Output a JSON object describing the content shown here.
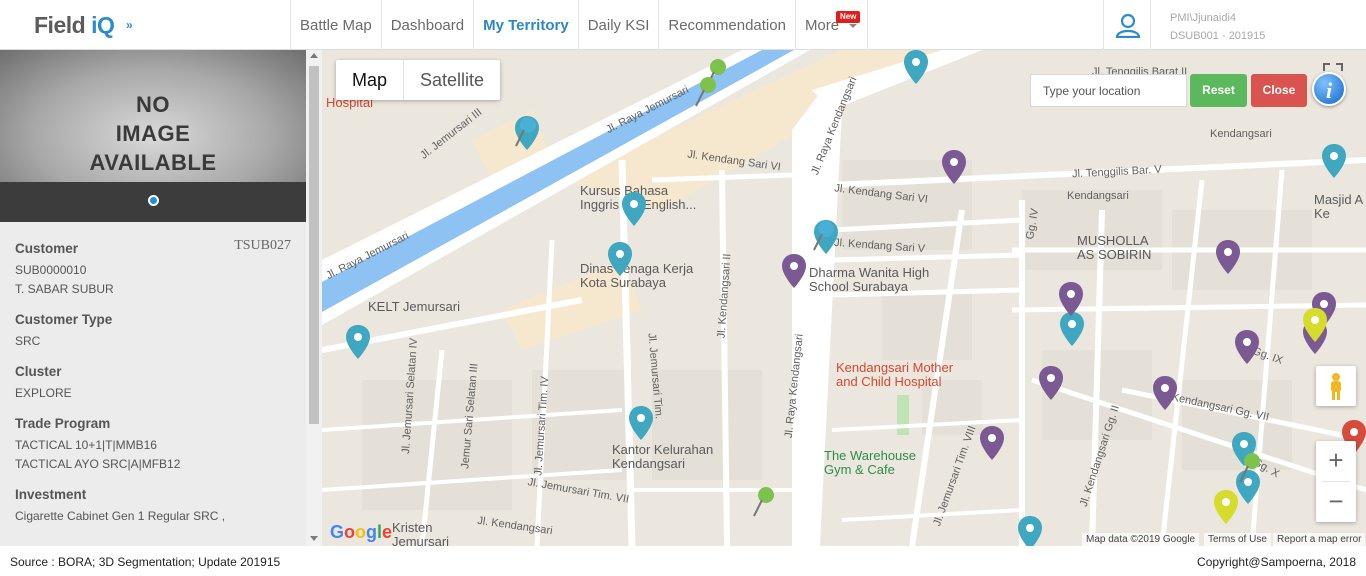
{
  "app": {
    "logo_text": "Field",
    "logo_accent": "iQ"
  },
  "nav": {
    "items": [
      {
        "label": "Battle Map"
      },
      {
        "label": "Dashboard"
      },
      {
        "label": "My Territory",
        "active": true
      },
      {
        "label": "Daily KSI"
      },
      {
        "label": "Recommendation"
      },
      {
        "label": "More"
      }
    ],
    "new_badge": "New"
  },
  "user": {
    "icon": "user-icon",
    "name": "PMI\\Jjunaidi4",
    "account": "DSUB001 - 201915"
  },
  "photo": {
    "placeholder_lines": [
      "NO",
      "IMAGE",
      "AVAILABLE"
    ]
  },
  "customer": {
    "customer_label": "Customer",
    "customer_code": "TSUB027",
    "customer_id": "SUB0000010",
    "customer_name": "T. SABAR SUBUR",
    "type_label": "Customer Type",
    "type_value": "SRC",
    "cluster_label": "Cluster",
    "cluster_value": "EXPLORE",
    "trade_label": "Trade Program",
    "trade_values": [
      "TACTICAL 10+1|T|MMB16",
      "TACTICAL AYO SRC|A|MFB12"
    ],
    "investment_label": "Investment",
    "investment_value": "Cigarette Cabinet Gen 1 Regular SRC ,"
  },
  "map": {
    "map_type": [
      "Map",
      "Satellite"
    ],
    "location_placeholder": "Type your location",
    "reset_label": "Reset",
    "close_label": "Close",
    "info_label": "i",
    "zoom_in": "+",
    "zoom_out": "−",
    "street_labels": [
      "Jl. Raya Jemursari",
      "Jl. Raya Jemursari",
      "Jl. Jemursari III",
      "Jl. Raya Kendangsari",
      "Jl. Kendang Sari VI",
      "Jl. Kendang Sari VI",
      "Jl. Kendang Sari V",
      "Jl. Tenggilis Bar. V",
      "Kendangsari",
      "Kendangsari",
      "Jl. Jemursari Tim.",
      "Jl. Kendangsari II",
      "Jl. Raya Kendangsari",
      "Jl. Jemursari Selatan IV",
      "Jl. Jemursari Tim. VII",
      "Jl. Jemursari Tim. VIII",
      "Jl. Kendangsari Gg. VII",
      "Jl. Kendangsari Gg. II",
      "Gg. IX",
      "Gg. X",
      "Jemur Sari Selatan III",
      "Jl. Jemursari Tim. IV",
      "Jl. Kendangsari",
      "Gg. IV",
      "Jl. Tenggilis Barat II"
    ],
    "poi_labels": [
      {
        "text": "Kursus Bahasa\nInggris EF English...",
        "style": ""
      },
      {
        "text": "Dinas Tenaga Kerja\nKota Surabaya",
        "style": ""
      },
      {
        "text": "KELT Jemursari",
        "style": ""
      },
      {
        "text": "Dharma Wanita High\nSchool Surabaya",
        "style": ""
      },
      {
        "text": "MUSHOLLA\nAS SOBIRIN",
        "style": ""
      },
      {
        "text": "Kendangsari Mother\nand Child Hospital",
        "style": "red"
      },
      {
        "text": "Kantor Kelurahan\nKendangsari",
        "style": ""
      },
      {
        "text": "The Warehouse\nGym & Cafe",
        "style": "green"
      },
      {
        "text": "Kristen\nJemursari",
        "style": ""
      },
      {
        "text": "Hospital",
        "style": "red"
      },
      {
        "text": "Masjid A\nKe",
        "style": ""
      }
    ],
    "attribution": [
      "Map data ©2019 Google",
      "Terms of Use",
      "Report a map error"
    ],
    "google_logo": "Google",
    "pin_colors": {
      "teal": "#3fa7c0",
      "purple": "#7b5a93",
      "green": "#7cc24d",
      "yellow": "#d6dc2b",
      "red": "#d64b3c"
    }
  },
  "footer": {
    "source": "Source : BORA; 3D Segmentation; Update 201915",
    "copyright": "Copyright@Sampoerna, 2018"
  }
}
